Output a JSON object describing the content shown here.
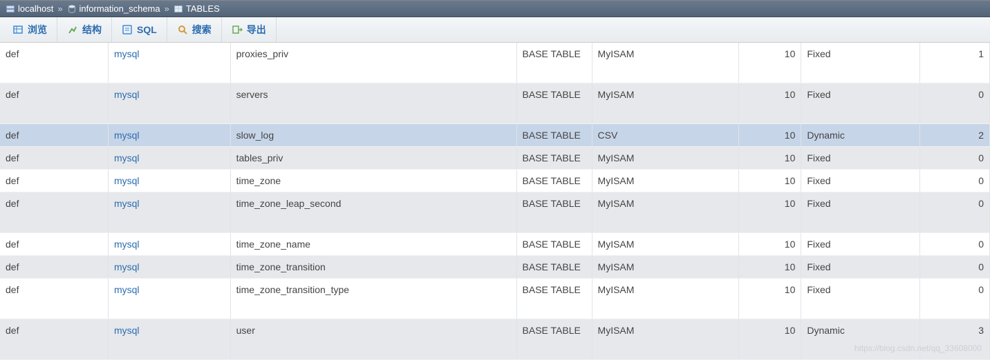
{
  "breadcrumb": {
    "server": "localhost",
    "database": "information_schema",
    "table": "TABLES"
  },
  "tabs": {
    "browse": "浏览",
    "structure": "结构",
    "sql": "SQL",
    "search": "搜索",
    "export": "导出"
  },
  "rows": [
    {
      "catalog": "def",
      "schema": "mysql",
      "name": "proxies_priv",
      "type": "BASE TABLE",
      "engine": "MyISAM",
      "version": 10,
      "row_format": "Fixed",
      "rows": 1,
      "odd": true,
      "tall": true
    },
    {
      "catalog": "def",
      "schema": "mysql",
      "name": "servers",
      "type": "BASE TABLE",
      "engine": "MyISAM",
      "version": 10,
      "row_format": "Fixed",
      "rows": 0,
      "odd": false,
      "tall": true
    },
    {
      "catalog": "def",
      "schema": "mysql",
      "name": "slow_log",
      "type": "BASE TABLE",
      "engine": "CSV",
      "version": 10,
      "row_format": "Dynamic",
      "rows": 2,
      "selected": true
    },
    {
      "catalog": "def",
      "schema": "mysql",
      "name": "tables_priv",
      "type": "BASE TABLE",
      "engine": "MyISAM",
      "version": 10,
      "row_format": "Fixed",
      "rows": 0,
      "odd": false
    },
    {
      "catalog": "def",
      "schema": "mysql",
      "name": "time_zone",
      "type": "BASE TABLE",
      "engine": "MyISAM",
      "version": 10,
      "row_format": "Fixed",
      "rows": 0,
      "odd": true
    },
    {
      "catalog": "def",
      "schema": "mysql",
      "name": "time_zone_leap_second",
      "type": "BASE TABLE",
      "engine": "MyISAM",
      "version": 10,
      "row_format": "Fixed",
      "rows": 0,
      "odd": false,
      "tall": true
    },
    {
      "catalog": "def",
      "schema": "mysql",
      "name": "time_zone_name",
      "type": "BASE TABLE",
      "engine": "MyISAM",
      "version": 10,
      "row_format": "Fixed",
      "rows": 0,
      "odd": true
    },
    {
      "catalog": "def",
      "schema": "mysql",
      "name": "time_zone_transition",
      "type": "BASE TABLE",
      "engine": "MyISAM",
      "version": 10,
      "row_format": "Fixed",
      "rows": 0,
      "odd": false
    },
    {
      "catalog": "def",
      "schema": "mysql",
      "name": "time_zone_transition_type",
      "type": "BASE TABLE",
      "engine": "MyISAM",
      "version": 10,
      "row_format": "Fixed",
      "rows": 0,
      "odd": true,
      "tall": true
    },
    {
      "catalog": "def",
      "schema": "mysql",
      "name": "user",
      "type": "BASE TABLE",
      "engine": "MyISAM",
      "version": 10,
      "row_format": "Dynamic",
      "rows": 3,
      "odd": false,
      "tall": true
    }
  ],
  "watermark": "https://blog.csdn.net/qq_33608000"
}
